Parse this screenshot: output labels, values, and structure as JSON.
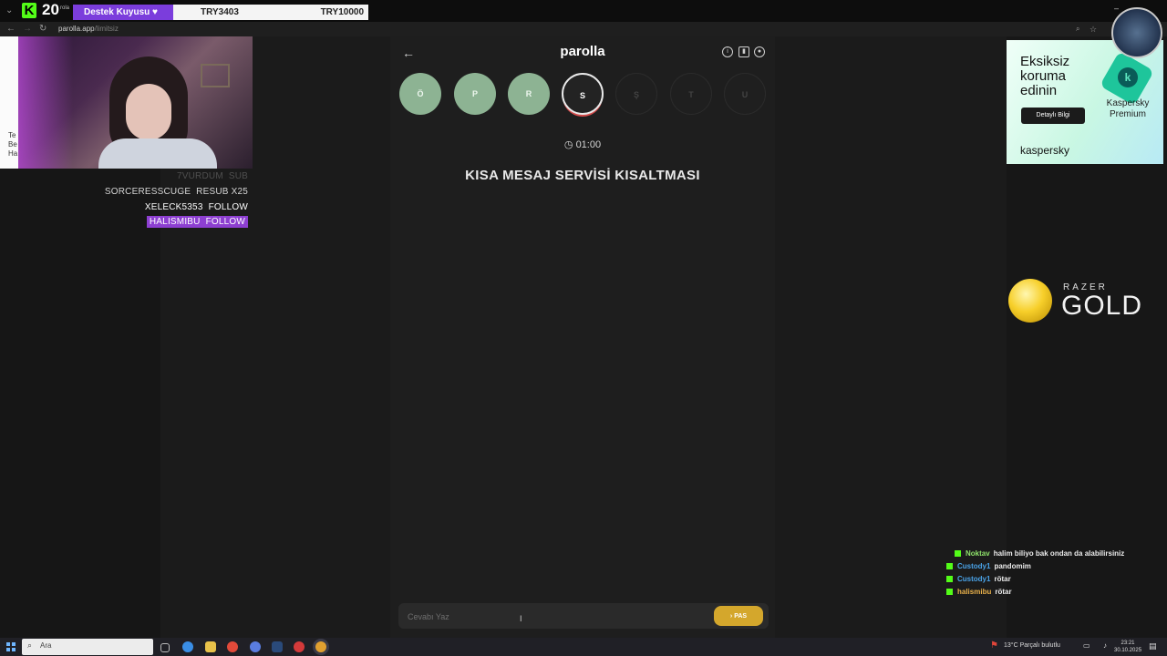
{
  "browser": {
    "url_host": "parolla.app",
    "url_path": "/limitsiz",
    "tab_mini_title": "rola"
  },
  "overlay": {
    "kick_count": "20",
    "donation_label": "Destek Kuyusu ♥",
    "donation_current": "TRY3403",
    "donation_goal": "TRY10000",
    "side_text": "Te\nBe\nHa",
    "events": [
      {
        "user": "7VURDUM",
        "type": "SUB"
      },
      {
        "user": "SORCERESSCUGE",
        "type": "RESUB X25"
      },
      {
        "user": "XELECK5353",
        "type": "FOLLOW"
      },
      {
        "user": "HALISMIBU",
        "type": "FOLLOW"
      }
    ]
  },
  "game": {
    "title": "parolla",
    "letters": [
      {
        "char": "Ö",
        "state": "done"
      },
      {
        "char": "P",
        "state": "done"
      },
      {
        "char": "R",
        "state": "done"
      },
      {
        "char": "S",
        "state": "current"
      },
      {
        "char": "Ş",
        "state": "next"
      },
      {
        "char": "T",
        "state": "next"
      },
      {
        "char": "U",
        "state": "next"
      }
    ],
    "timer": "01:00",
    "question": "KISA MESAJ SERVİSİ KISALTMASI",
    "answer_placeholder": "Cevabı Yaz",
    "pass_label": "PAS",
    "icons": {
      "back": "arrow-left",
      "info": "info-circle",
      "stats": "bar-chart",
      "user": "user-circle"
    }
  },
  "ads": {
    "kaspersky": {
      "headline": "Eksiksiz koruma edinin",
      "button": "Detaylı Bilgi",
      "product": "Kaspersky Premium",
      "brand": "kaspersky",
      "logo_letter": "k"
    },
    "razer": {
      "small": "RAZER",
      "big": "GOLD"
    }
  },
  "chat": [
    {
      "user": "Noktav",
      "color": "#8fe36b",
      "message": "halim biliyo bak ondan da alabilirsiniz"
    },
    {
      "user": "Custody1",
      "color": "#4aa3e8",
      "message": "pandomim"
    },
    {
      "user": "Custody1",
      "color": "#4aa3e8",
      "message": "rötar"
    },
    {
      "user": "halismibu",
      "color": "#e8b04a",
      "message": "rötar"
    }
  ],
  "taskbar": {
    "search_label": "Ara",
    "weather": "13°C  Parçalı bulutlu",
    "time": "23:21",
    "date": "30.10.2025"
  },
  "colors": {
    "accent_purple": "#7b3ddc",
    "kick_green": "#53fc18",
    "pass_gold": "#d4a72c",
    "done_green": "#8db393"
  }
}
